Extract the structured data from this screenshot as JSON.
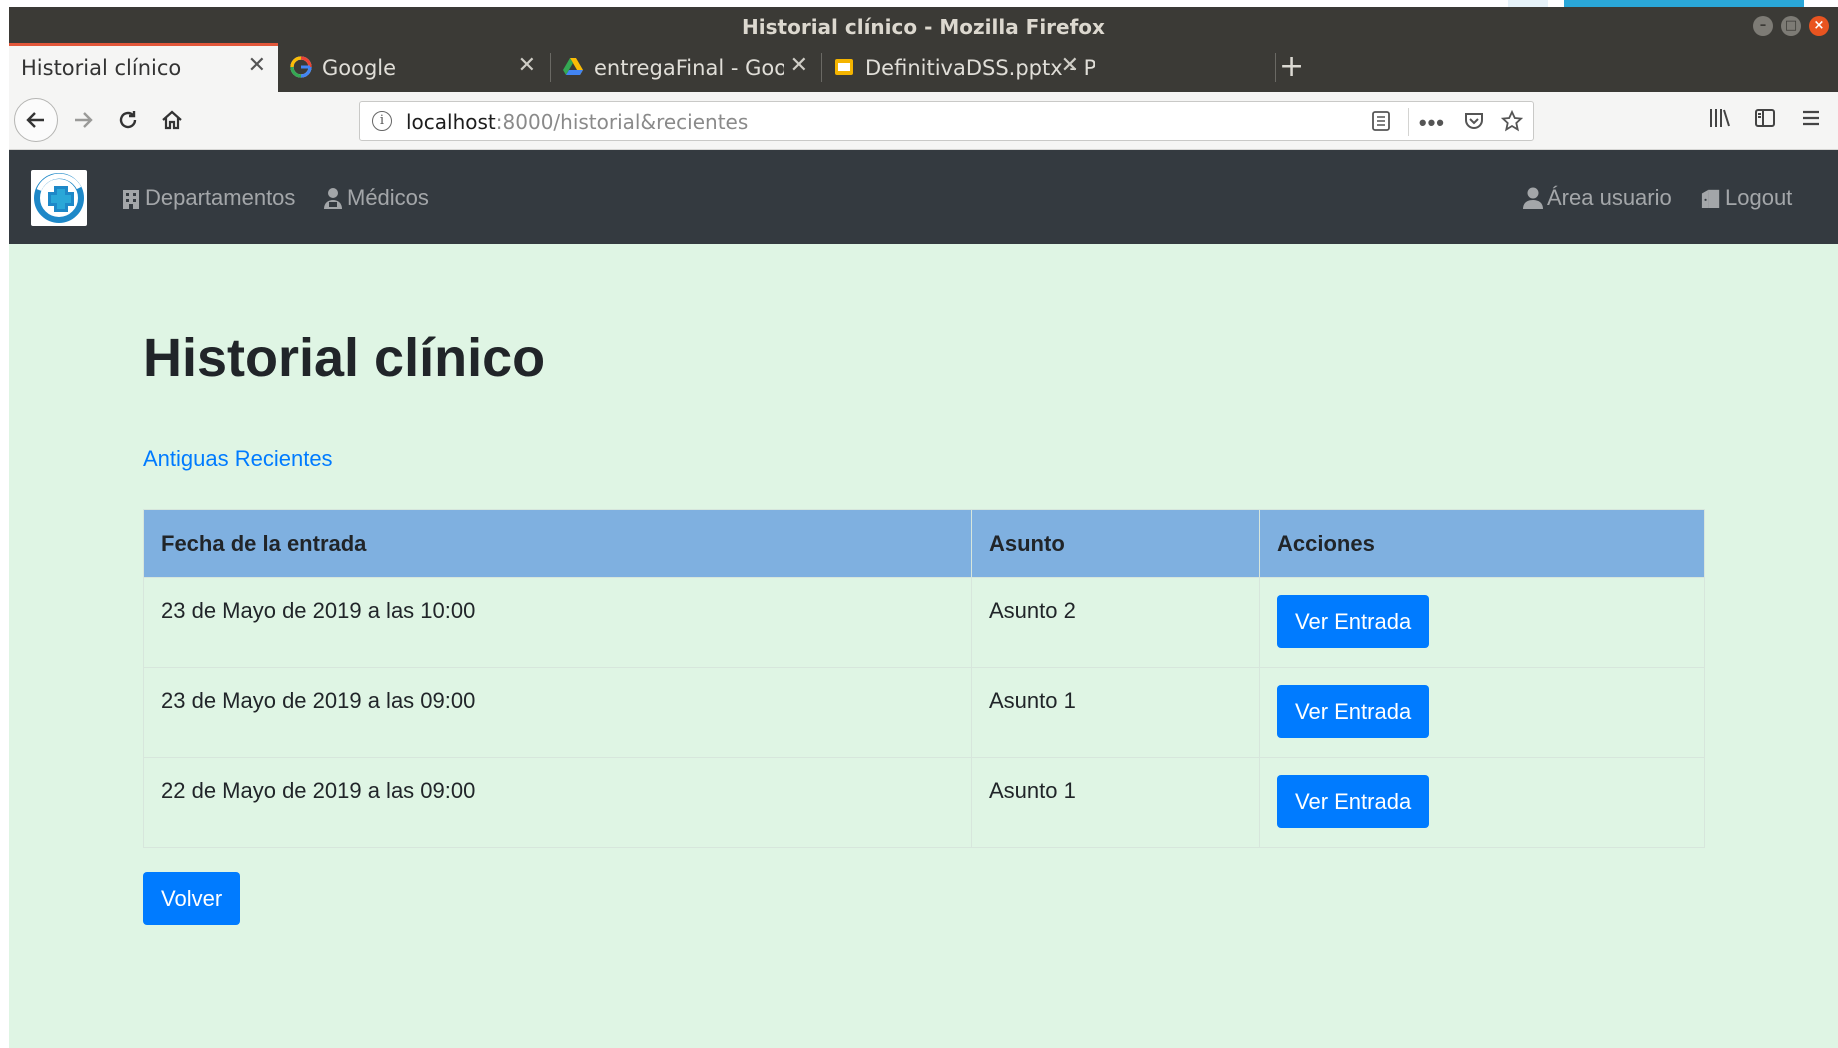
{
  "window": {
    "title": "Historial clínico - Mozilla Firefox"
  },
  "tabs": [
    {
      "label": "Historial clínico",
      "active": true,
      "icon": "none"
    },
    {
      "label": "Google",
      "active": false,
      "icon": "google-icon"
    },
    {
      "label": "entregaFinal - Google Dri",
      "active": false,
      "icon": "google-drive-icon"
    },
    {
      "label": "DefinitivaDSS.pptx - Pres",
      "active": false,
      "icon": "google-slides-icon"
    }
  ],
  "new_tab_label": "+",
  "tab_close_glyph": "✕",
  "urlbar": {
    "host": "localhost",
    "path": ":8000/historial&recientes"
  },
  "site_nav": {
    "departamentos": "Departamentos",
    "medicos": "Médicos",
    "area_usuario": "Área usuario",
    "logout": "Logout"
  },
  "page": {
    "title": "Historial clínico",
    "sort_link": "Antiguas Recientes"
  },
  "table": {
    "headers": [
      "Fecha de la entrada",
      "Asunto",
      "Acciones"
    ],
    "rows": [
      {
        "fecha": "23 de Mayo de 2019 a las 10:00",
        "asunto": "Asunto 2",
        "accion": "Ver Entrada"
      },
      {
        "fecha": "23 de Mayo de 2019 a las 09:00",
        "asunto": "Asunto 1",
        "accion": "Ver Entrada"
      },
      {
        "fecha": "22 de Mayo de 2019 a las 09:00",
        "asunto": "Asunto 1",
        "accion": "Ver Entrada"
      }
    ]
  },
  "volver_label": "Volver",
  "colors": {
    "navbar": "#343a40",
    "page_bg": "#dff5e4",
    "table_header": "#7fb0e0",
    "primary": "#007bff",
    "link": "#007bff"
  }
}
